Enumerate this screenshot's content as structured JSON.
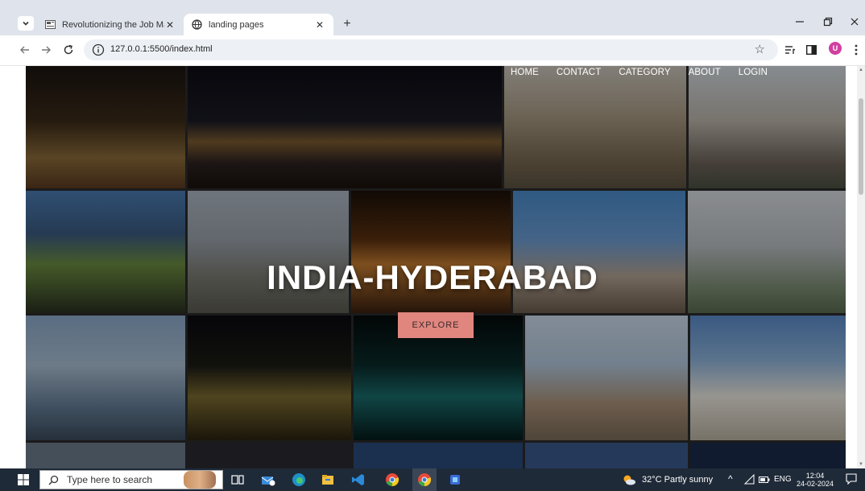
{
  "browser": {
    "tabs": [
      {
        "title": "Revolutionizing the Job Market",
        "icon": "news-favicon-icon",
        "close": "✕"
      },
      {
        "title": "landing pages",
        "icon": "globe-favicon-icon",
        "close": "✕"
      }
    ],
    "new_tab": "+",
    "url": "127.0.0.1:5500/index.html",
    "profile_initial": "U"
  },
  "page": {
    "nav": [
      "HOME",
      "CONTACT",
      "CATEGORY",
      "ABOUT",
      "LOGIN"
    ],
    "hero_title": "INDIA-HYDERABAD",
    "explore_label": "EXPLORE",
    "accent": "#e0867f"
  },
  "taskbar": {
    "search_placeholder": "Type here to search",
    "weather": "32°C  Partly sunny",
    "language": "ENG",
    "time": "12:04",
    "date": "24-02-2024"
  }
}
